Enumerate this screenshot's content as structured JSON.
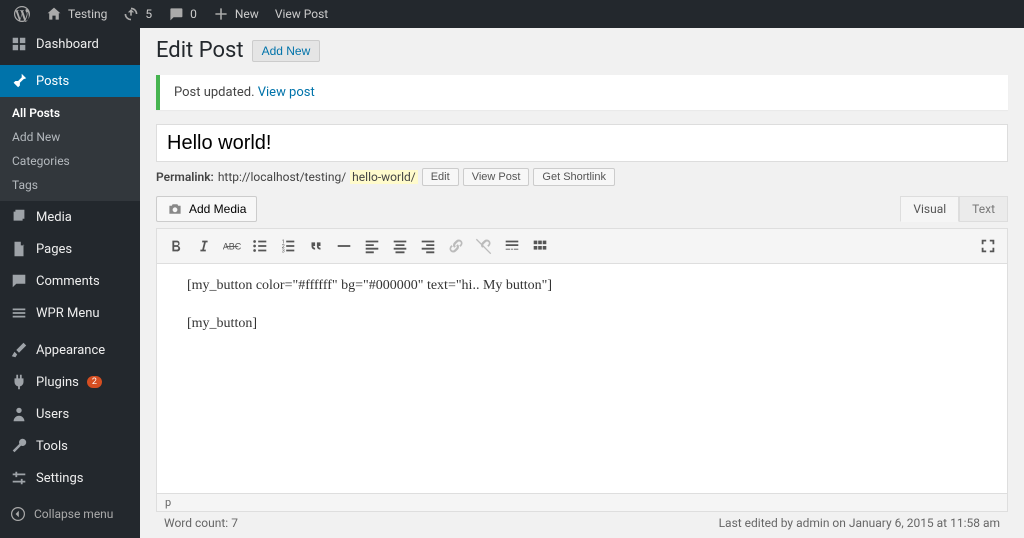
{
  "admin_bar": {
    "site_name": "Testing",
    "updates_count": "5",
    "comments_count": "0",
    "new_label": "New",
    "view_post_label": "View Post"
  },
  "sidebar": {
    "items": [
      {
        "label": "Dashboard",
        "icon": "dashboard"
      },
      {
        "label": "Posts",
        "icon": "posts",
        "active": true
      },
      {
        "label": "Media",
        "icon": "media"
      },
      {
        "label": "Pages",
        "icon": "pages"
      },
      {
        "label": "Comments",
        "icon": "comments"
      },
      {
        "label": "WPR Menu",
        "icon": "menu"
      },
      {
        "label": "Appearance",
        "icon": "appearance"
      },
      {
        "label": "Plugins",
        "icon": "plugins",
        "badge": "2"
      },
      {
        "label": "Users",
        "icon": "users"
      },
      {
        "label": "Tools",
        "icon": "tools"
      },
      {
        "label": "Settings",
        "icon": "settings"
      }
    ],
    "submenu": [
      {
        "label": "All Posts",
        "active": true
      },
      {
        "label": "Add New"
      },
      {
        "label": "Categories"
      },
      {
        "label": "Tags"
      }
    ],
    "collapse_label": "Collapse menu"
  },
  "page": {
    "title": "Edit Post",
    "add_new_label": "Add New"
  },
  "notice": {
    "text": "Post updated. ",
    "link": "View post"
  },
  "post": {
    "title": "Hello world!",
    "permalink_label": "Permalink:",
    "permalink_base": "http://localhost/testing/",
    "permalink_slug": "hello-world/",
    "edit_btn": "Edit",
    "view_post_btn": "View Post",
    "get_shortlink_btn": "Get Shortlink",
    "add_media_btn": "Add Media",
    "content": [
      "[my_button color=\"#ffffff\" bg=\"#000000\" text=\"hi.. My button\"]",
      "[my_button]"
    ]
  },
  "editor": {
    "tabs": [
      {
        "label": "Visual",
        "active": true
      },
      {
        "label": "Text"
      }
    ],
    "path": "p",
    "word_count_label": "Word count: ",
    "word_count": "7",
    "last_edited": "Last edited by admin on January 6, 2015 at 11:58 am"
  },
  "badge_color": "#d54e21",
  "accent_color": "#0073aa"
}
